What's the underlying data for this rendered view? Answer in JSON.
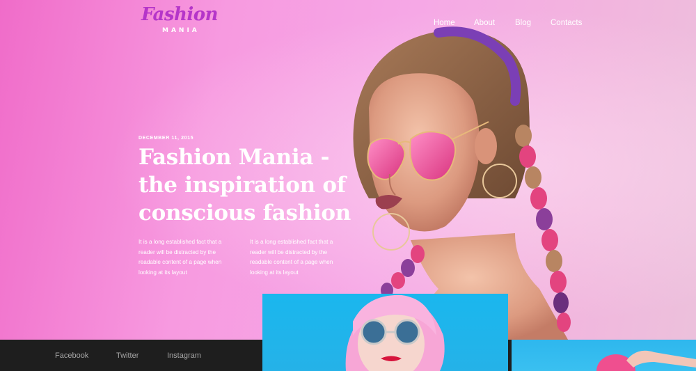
{
  "brand": {
    "logo_script": "Fashion",
    "logo_sub": "MANIA",
    "accent_color": "#b535c9"
  },
  "nav": {
    "items": [
      "Home",
      "About",
      "Blog",
      "Contacts"
    ]
  },
  "hero": {
    "date": "DECEMBER 11, 2015",
    "headline": "Fashion Mania - the inspiration of conscious fashion",
    "paragraphs": [
      "It is a long established fact that a reader will be distracted by the readable content of a page when looking at its layout",
      "It is a long established fact that a reader will be distracted by the readable content of a page when looking at its layout"
    ]
  },
  "footer": {
    "social": [
      "Facebook",
      "Twitter",
      "Instagram"
    ]
  },
  "colors": {
    "background_left": "#f06cc9",
    "background_right": "#ecc1dc",
    "footer_bg": "#1e1e1e",
    "thumb_blue": "#1ab7ee"
  }
}
